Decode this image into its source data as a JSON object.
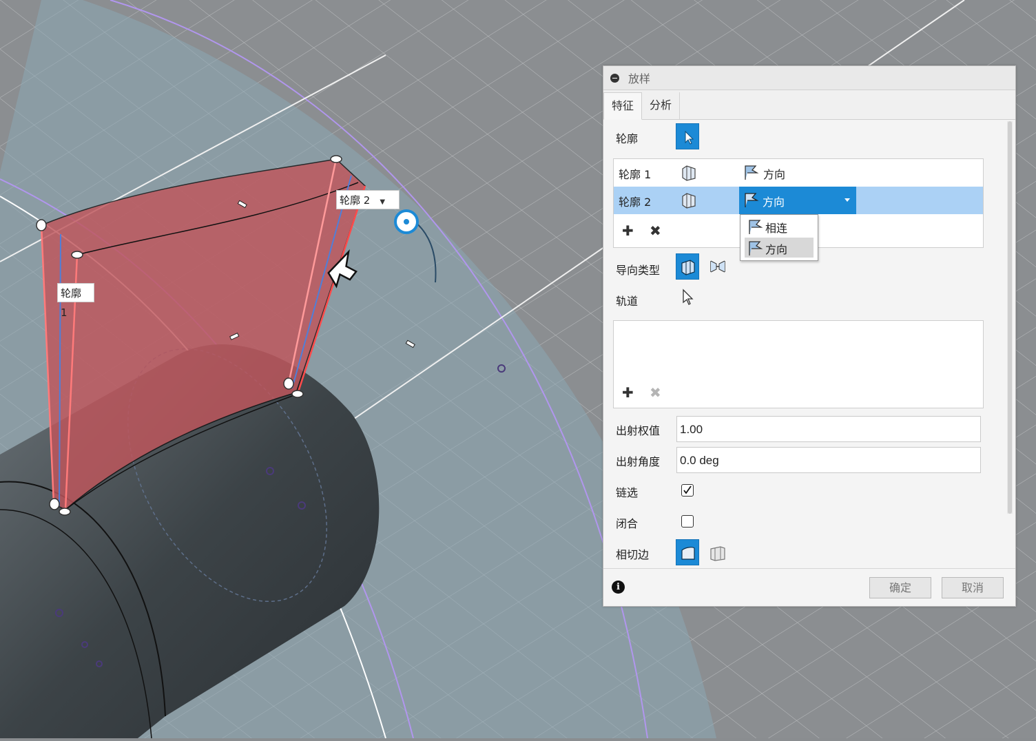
{
  "viewport": {
    "label_profile1": "轮廓 1",
    "label_profile2": "轮廓 2"
  },
  "dialog": {
    "title": "放样",
    "tabs": [
      "特征",
      "分析"
    ],
    "profiles_label": "轮廓",
    "profile_rows": [
      {
        "name": "轮廓 1",
        "condition": "方向"
      },
      {
        "name": "轮廓 2",
        "condition": "方向"
      }
    ],
    "dropdown_options": [
      "相连",
      "方向"
    ],
    "guide_type_label": "导向类型",
    "rails_label": "轨道",
    "takeoff_weight_label": "出射权值",
    "takeoff_weight_value": "1.00",
    "takeoff_angle_label": "出射角度",
    "takeoff_angle_value": "0.0 deg",
    "chain_select_label": "链选",
    "chain_select_checked": true,
    "closed_label": "闭合",
    "closed_checked": false,
    "tangent_edges_label": "相切边",
    "ok_label": "确定",
    "cancel_label": "取消"
  },
  "colors": {
    "accent": "#1c8ad6",
    "selected_row": "#abd1f5",
    "loft_surface": "#c0565c",
    "guide_circle": "#b196ee"
  }
}
